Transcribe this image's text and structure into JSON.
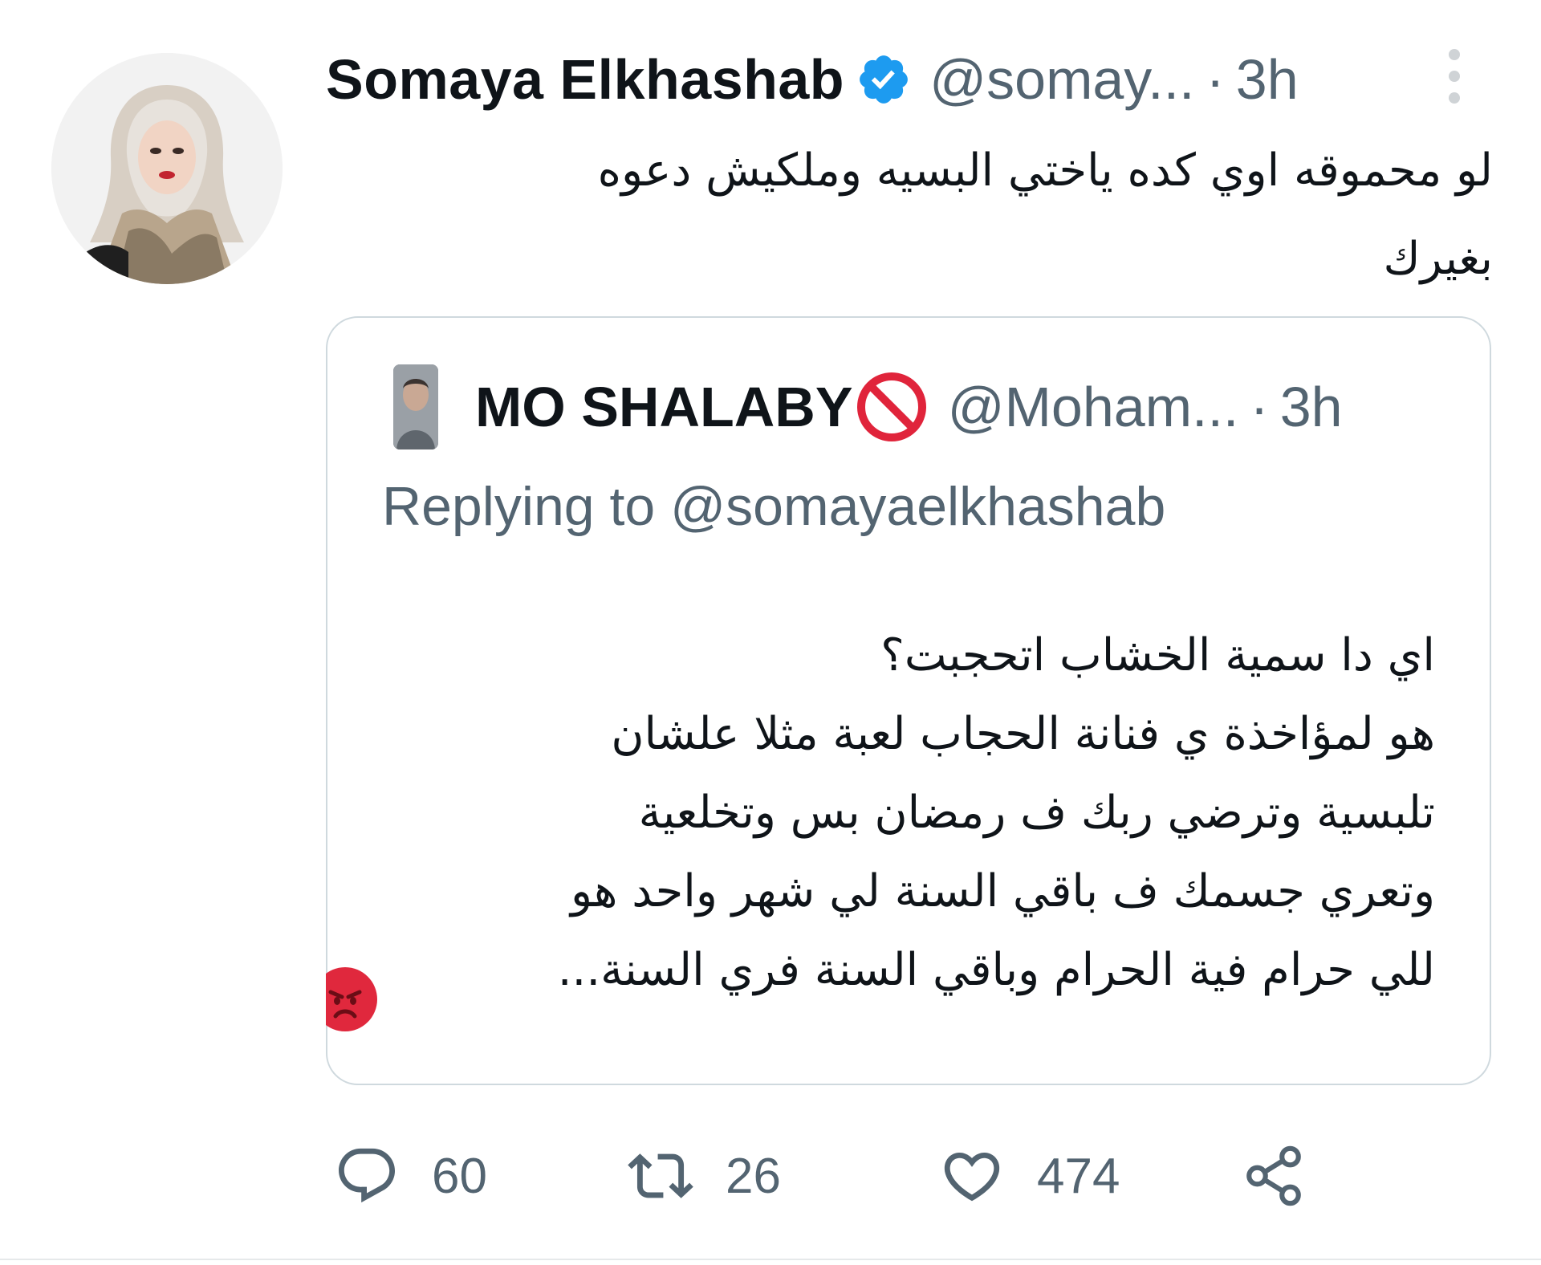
{
  "tweet": {
    "author_name": "Somaya Elkhashab",
    "handle": "@somay...",
    "separator": "·",
    "time": "3h",
    "text_line_1": "لو محموقه اوي كده ياختي البسيه وملكيش دعوه",
    "text_line_2": "بغيرك"
  },
  "quoted_tweet": {
    "author_name": "MO SHALABY",
    "handle": "@Moham...",
    "separator": "·",
    "time": "3h",
    "replying_prefix": "Replying to",
    "replying_handle": "@somayaelkhashab",
    "lines": [
      "اي دا سمية الخشاب اتحجبت؟",
      "هو لمؤاخذة ي فنانة الحجاب لعبة مثلا علشان",
      "تلبسية وترضي ربك ف رمضان بس وتخلعية",
      "وتعري جسمك ف باقي السنة لي شهر واحد هو",
      "للي حرام فية الحرام وباقي السنة فري السنة..."
    ]
  },
  "actions": {
    "reply_count": "60",
    "retweet_count": "26",
    "like_count": "474"
  },
  "icons": {
    "verified": "verified-badge-icon",
    "more": "more-vertical-icon",
    "prohibited": "prohibited-emoji-icon",
    "angry": "angry-face-emoji-icon",
    "reply": "reply-icon",
    "retweet": "retweet-icon",
    "like": "heart-icon",
    "share": "share-icon"
  },
  "colors": {
    "verified": "#1d9bf0",
    "secondary_text": "#536471",
    "border": "#cfd9de",
    "prohibited_red": "#e0243b",
    "angry_red": "#e0283d"
  }
}
